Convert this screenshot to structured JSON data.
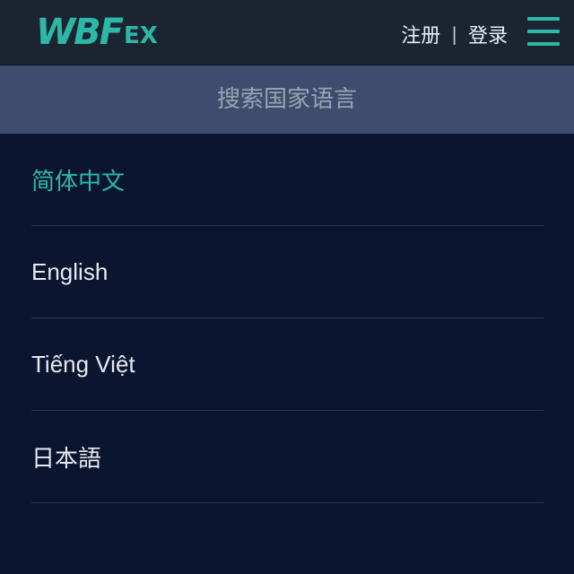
{
  "header": {
    "logo_main": "WBF",
    "logo_sub": "EX",
    "register_label": "注册",
    "separator": "|",
    "login_label": "登录",
    "menu_icon": "hamburger-icon"
  },
  "search": {
    "placeholder": "搜索国家语言"
  },
  "languages": [
    {
      "label": "简体中文",
      "active": true
    },
    {
      "label": "English",
      "active": false
    },
    {
      "label": "Tiếng Việt",
      "active": false
    },
    {
      "label": "日本語",
      "active": false
    }
  ],
  "colors": {
    "accent": "#2cb8a8",
    "header_bg": "#1b2532",
    "search_bg": "#3e4d6e",
    "page_bg": "#0b1530"
  }
}
